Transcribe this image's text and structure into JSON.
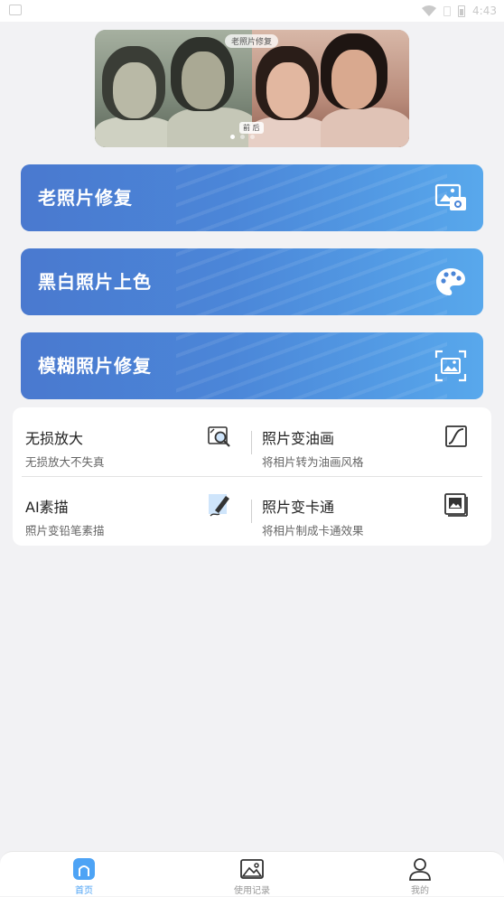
{
  "status_bar": {
    "time": "4:43"
  },
  "banner": {
    "tag": "老照片修复",
    "compare_label": "前 后",
    "dots": 3,
    "active_dot": 0
  },
  "features": [
    {
      "label": "老照片修复",
      "icon": "photo-camera-icon"
    },
    {
      "label": "黑白照片上色",
      "icon": "palette-icon"
    },
    {
      "label": "模糊照片修复",
      "icon": "focus-image-icon"
    }
  ],
  "tools": [
    {
      "title": "无损放大",
      "subtitle": "无损放大不失真",
      "icon": "magnify-image-icon"
    },
    {
      "title": "照片变油画",
      "subtitle": "将相片转为油画风格",
      "icon": "curve-icon"
    },
    {
      "title": "AI素描",
      "subtitle": "照片变铅笔素描",
      "icon": "pen-sketch-icon"
    },
    {
      "title": "照片变卡通",
      "subtitle": "将相片制成卡通效果",
      "icon": "picture-frame-icon"
    }
  ],
  "tabbar": [
    {
      "label": "首页",
      "icon": "home-icon",
      "active": true
    },
    {
      "label": "使用记录",
      "icon": "image-history-icon",
      "active": false
    },
    {
      "label": "我的",
      "icon": "user-icon",
      "active": false
    }
  ],
  "colors": {
    "accent": "#4da3f5",
    "card_gradient_start": "#4a79cf",
    "card_gradient_end": "#58a8ec",
    "background": "#f2f2f4"
  }
}
